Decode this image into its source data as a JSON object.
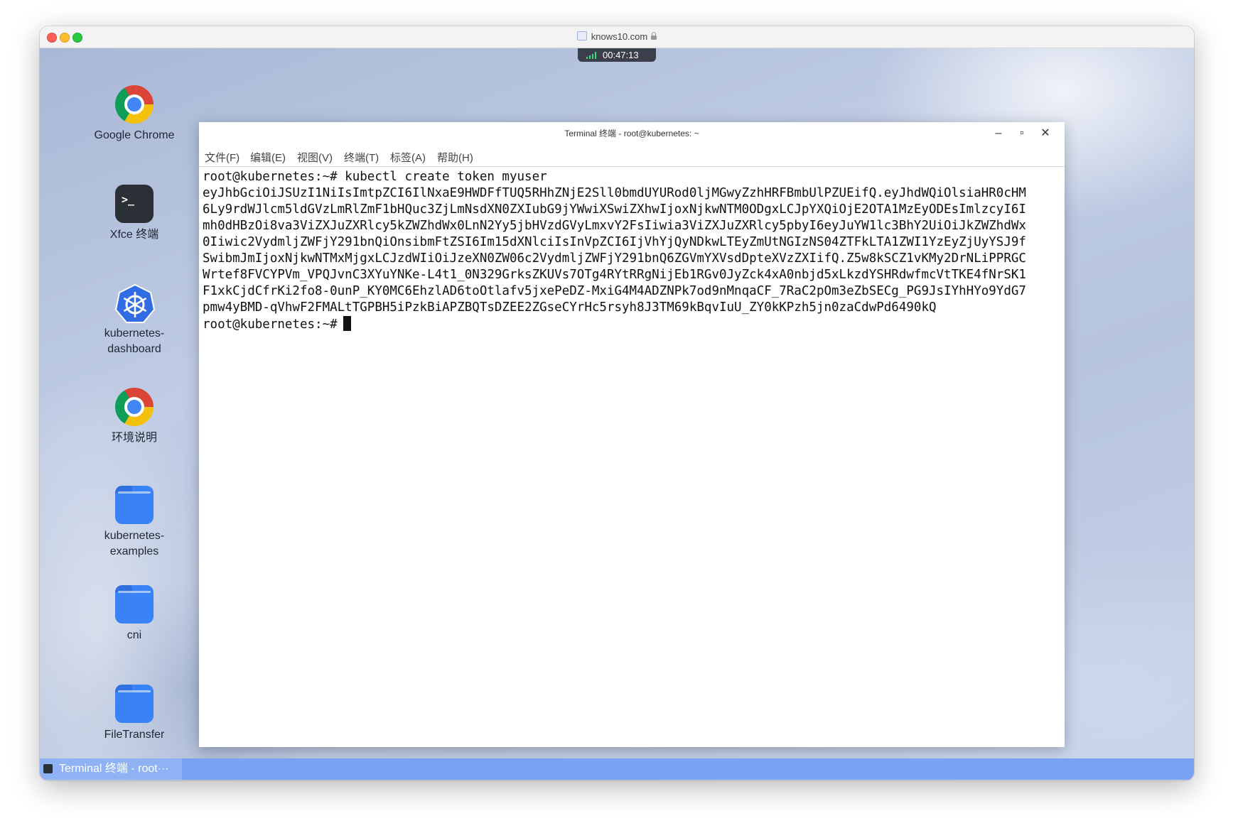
{
  "browser": {
    "url": "knows10.com"
  },
  "session": {
    "timer": "00:47:13"
  },
  "desktop_icons": [
    {
      "label": "Google Chrome",
      "icon": "chrome-icon"
    },
    {
      "label": "Xfce 终端",
      "icon": "terminal-icon"
    },
    {
      "label": "kubernetes-dashboard",
      "icon": "kubernetes-icon"
    },
    {
      "label": "环境说明",
      "icon": "chrome-icon"
    },
    {
      "label": "kubernetes-examples",
      "icon": "folder-icon"
    },
    {
      "label": "cni",
      "icon": "folder-icon"
    },
    {
      "label": "FileTransfer",
      "icon": "folder-icon"
    }
  ],
  "terminal": {
    "title": "Terminal 终端 - root@kubernetes: ~",
    "controls": {
      "minimize": "–",
      "maximize": "▫",
      "close": "✕"
    },
    "menu": [
      "文件(F)",
      "编辑(E)",
      "视图(V)",
      "终端(T)",
      "标签(A)",
      "帮助(H)"
    ],
    "lines": [
      "root@kubernetes:~# kubectl create token myuser",
      "eyJhbGciOiJSUzI1NiIsImtpZCI6IlNxaE9HWDFfTUQ5RHhZNjE2Sll0bmdUYURod0ljMGwyZzhHRFBmbUlPZUEifQ.eyJhdWQiOlsiaHR0cHM",
      "6Ly9rdWJlcm5ldGVzLmRlZmF1bHQuc3ZjLmNsdXN0ZXIubG9jYWwiXSwiZXhwIjoxNjkwNTM0ODgxLCJpYXQiOjE2OTA1MzEyODEsImlzcyI6I",
      "mh0dHBzOi8va3ViZXJuZXRlcy5kZWZhdWx0LnN2Yy5jbHVzdGVyLmxvY2FsIiwia3ViZXJuZXRlcy5pbyI6eyJuYW1lc3BhY2UiOiJkZWZhdWx",
      "0Iiwic2VydmljZWFjY291bnQiOnsibmFtZSI6Im15dXNlciIsInVpZCI6IjVhYjQyNDkwLTEyZmUtNGIzNS04ZTFkLTA1ZWI1YzEyZjUyYSJ9f",
      "SwibmJmIjoxNjkwNTMxMjgxLCJzdWIiOiJzeXN0ZW06c2VydmljZWFjY291bnQ6ZGVmYXVsdDpteXVzZXIifQ.Z5w8kSCZ1vKMy2DrNLiPPRGC",
      "Wrtef8FVCYPVm_VPQJvnC3XYuYNKe-L4t1_0N329GrksZKUVs7OTg4RYtRRgNijEb1RGv0JyZck4xA0nbjd5xLkzdYSHRdwfmcVtTKE4fNrSK1",
      "F1xkCjdCfrKi2fo8-0unP_KY0MC6EhzlAD6toOtlafv5jxePeDZ-MxiG4M4ADZNPk7od9nMnqaCF_7RaC2pOm3eZbSECg_PG9JsIYhHYo9YdG7",
      "pmw4yBMD-qVhwF2FMALtTGPBH5iPzkBiAPZBQTsDZEE2ZGseCYrHc5rsyh8J3TM69kBqvIuU_ZY0kKPzh5jn0zaCdwPd6490kQ"
    ],
    "prompt": "root@kubernetes:~#"
  },
  "taskbar": {
    "items": [
      {
        "label": "Terminal 终端 - root···",
        "icon": "terminal-icon"
      }
    ]
  }
}
